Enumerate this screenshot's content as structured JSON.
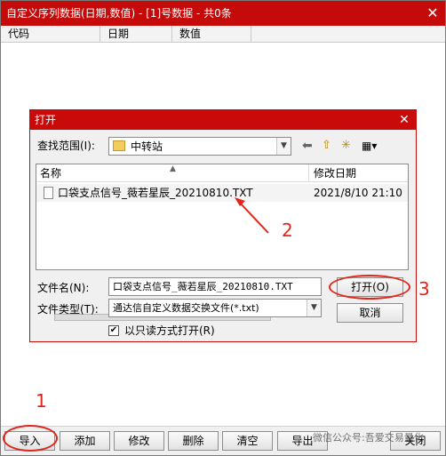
{
  "app": {
    "title": "自定义序列数据(日期,数值) - [1]号数据 - 共0条",
    "close_glyph": "✕",
    "columns": [
      "代码",
      "日期",
      "数值"
    ]
  },
  "toolbar": {
    "buttons": [
      "导入",
      "添加",
      "修改",
      "删除",
      "清空",
      "导出",
      "关闭"
    ]
  },
  "dialog": {
    "title": "打开",
    "close_glyph": "✕",
    "lookin_label": "查找范围(I):",
    "lookin_value": "中转站",
    "list_headers": {
      "name": "名称",
      "modified": "修改日期"
    },
    "file": {
      "name": "口袋支点信号_薇若星辰_20210810.TXT",
      "modified": "2021/8/10 21:10"
    },
    "filename_label": "文件名(N):",
    "filename_value": "口袋支点信号_薇若星辰_20210810.TXT",
    "filetype_label": "文件类型(T):",
    "filetype_value": "通达信自定义数据交换文件(*.txt)",
    "readonly_label": "以只读方式打开(R)",
    "readonly_checked": "✔",
    "open_button": "打开(O)",
    "cancel_button": "取消"
  },
  "annotations": [
    "1",
    "2",
    "3"
  ],
  "watermark": "微信公众号:吾爱交易量化",
  "colors": {
    "titlebar": "#c50a0a",
    "annotation": "#e0251b"
  }
}
